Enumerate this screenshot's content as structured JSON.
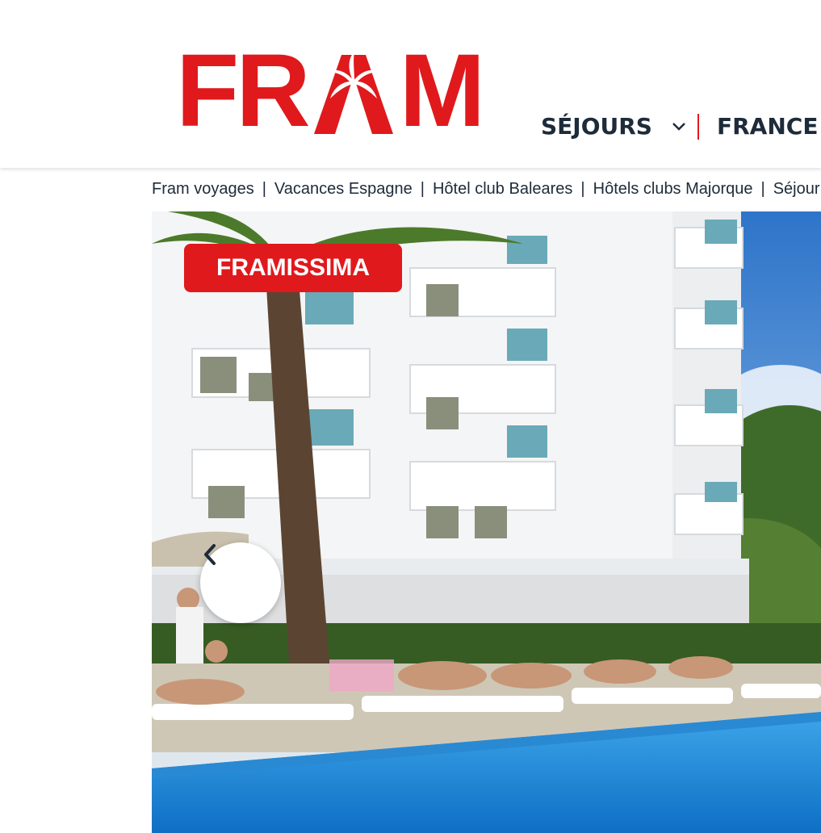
{
  "brand": {
    "logo_text_left": "FR",
    "logo_text_right": "M",
    "logo_color": "#e0191d",
    "logo_icon": "palm-tree-icon"
  },
  "nav": {
    "items": [
      {
        "label": "SÉJOURS",
        "icon": "chevron-down-icon"
      },
      {
        "label": "FRANCE",
        "icon": "chevron-down-icon"
      }
    ],
    "separator_color": "#e0191d"
  },
  "breadcrumb": {
    "items": [
      "Fram voyages",
      "Vacances Espagne",
      "Hôtel club Baleares",
      "Hôtels clubs Majorque",
      "Séjour Pu"
    ],
    "separator": "|"
  },
  "hero": {
    "badge_text": "FRAMISSIMA",
    "badge_color": "#e0191d",
    "prev_icon": "chevron-left-icon"
  }
}
